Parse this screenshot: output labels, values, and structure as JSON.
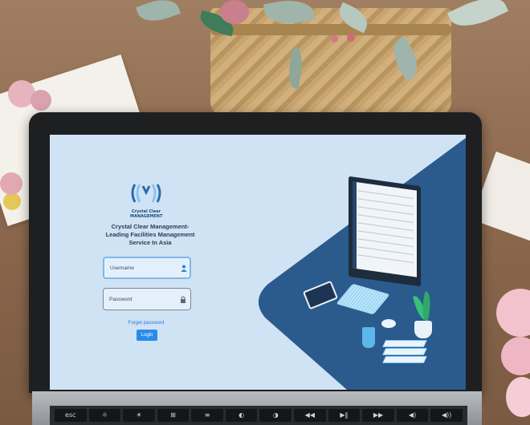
{
  "login": {
    "logo_text_line1": "Crystal Clear",
    "logo_text_line2": "MANAGEMENT",
    "tagline_line1": "Crystal Clear Management-",
    "tagline_line2": "Leading Facilities Management",
    "tagline_line3": "Service In Asia",
    "username_placeholder": "Username",
    "password_placeholder": "Password",
    "forgot_password": "Forget password",
    "login_button": "Login"
  },
  "keyboard": {
    "keys": [
      "esc",
      "☼",
      "☀",
      "⊞",
      "≡",
      "◐",
      "◑",
      "◀◀",
      "▶‖",
      "▶▶",
      "◀)",
      "◀))"
    ]
  },
  "colors": {
    "screen_bg": "#cfe3f5",
    "illustration_navy": "#2b5a8c",
    "accent_blue": "#2b8bea",
    "link_blue": "#2f78d4",
    "logo_blue": "#1d4a7a"
  },
  "icons": {
    "username": "user-icon",
    "password": "lock-icon"
  }
}
